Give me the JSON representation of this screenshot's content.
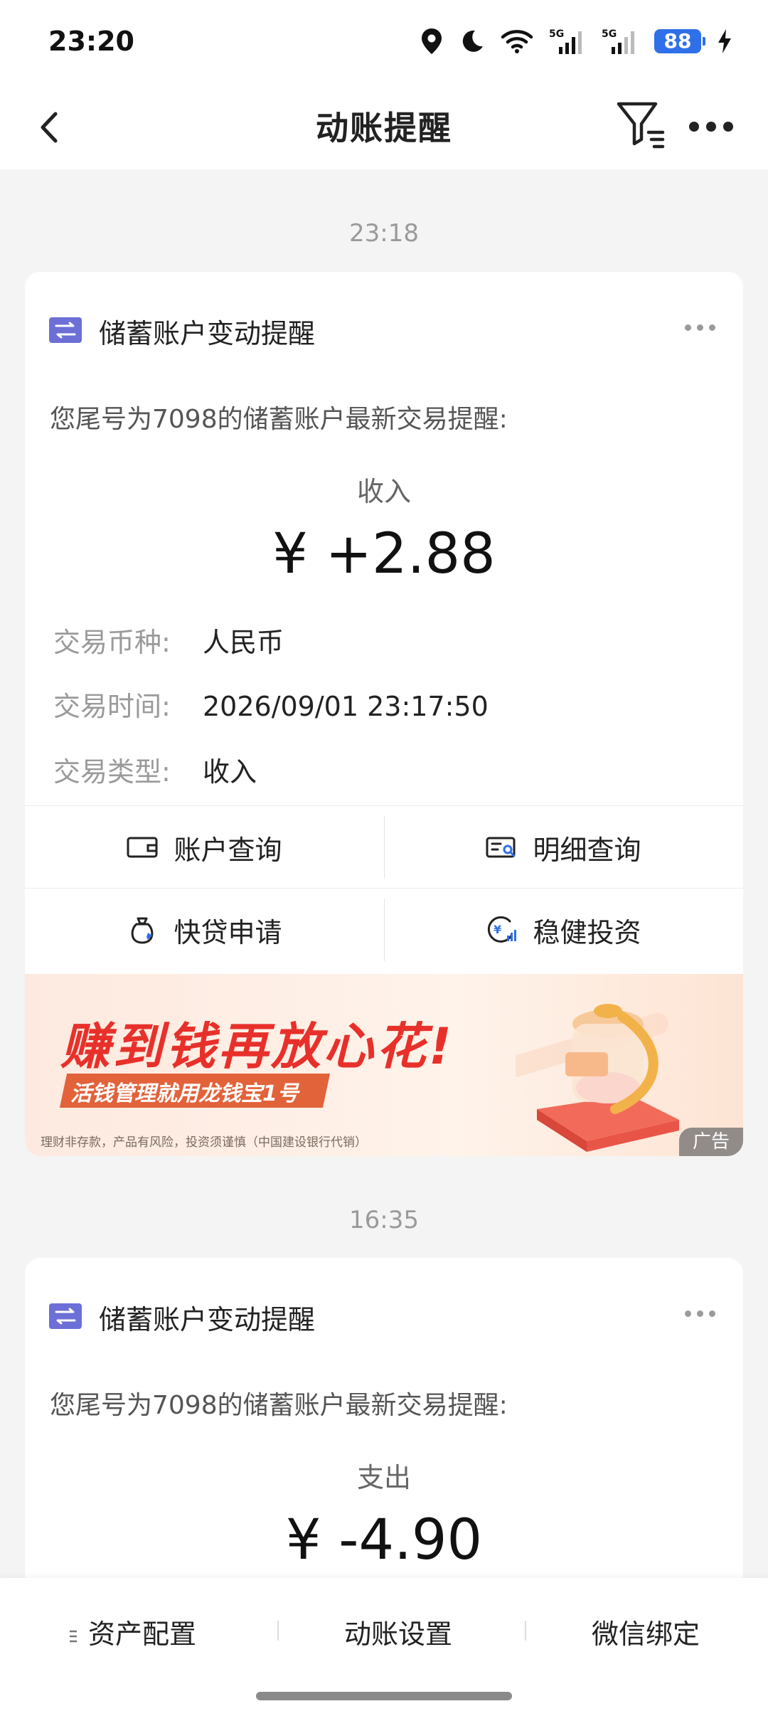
{
  "status": {
    "time": "23:20",
    "battery": "88",
    "signal_label": "5G"
  },
  "nav": {
    "title": "动账提醒"
  },
  "messages": [
    {
      "time": "23:18",
      "title": "储蓄账户变动提醒",
      "intro": "您尾号为7098的储蓄账户最新交易提醒:",
      "type": "收入",
      "amount": "¥ +2.88",
      "fields": [
        {
          "key": "交易币种:",
          "value": "人民币"
        },
        {
          "key": "交易时间:",
          "value": "2026/09/01 23:17:50"
        },
        {
          "key": "交易类型:",
          "value": "收入"
        }
      ],
      "actions": [
        {
          "label": "账户查询",
          "icon": "wallet-icon"
        },
        {
          "label": "明细查询",
          "icon": "detail-search-icon"
        },
        {
          "label": "快贷申请",
          "icon": "loan-bag-icon"
        },
        {
          "label": "稳健投资",
          "icon": "investment-icon"
        }
      ],
      "banner": {
        "headline": "赚到钱再放心花!",
        "subline": "活钱管理就用龙钱宝1号",
        "disclaimer": "理财非存款，产品有风险，投资须谨慎（中国建设银行代销）",
        "ad_tag": "广告"
      }
    },
    {
      "time": "16:35",
      "title": "储蓄账户变动提醒",
      "intro": "您尾号为7098的储蓄账户最新交易提醒:",
      "type": "支出",
      "amount": "¥ -4.90"
    }
  ],
  "bottom_tabs": [
    {
      "label": "资产配置"
    },
    {
      "label": "动账设置"
    },
    {
      "label": "微信绑定"
    }
  ],
  "colors": {
    "accent": "#2f6fe8",
    "card_icon": "#6b6fd6",
    "banner_red": "#e8302a"
  }
}
